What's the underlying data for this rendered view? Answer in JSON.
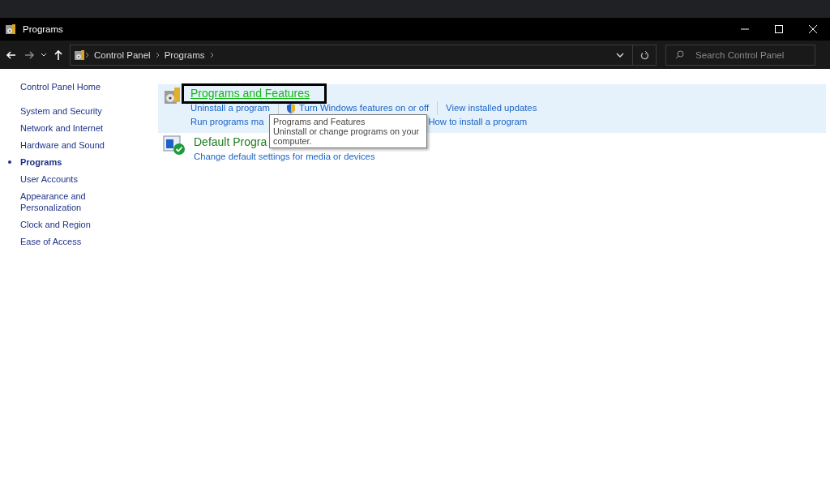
{
  "window": {
    "title": "Programs"
  },
  "address_bar": {
    "crumbs": [
      "Control Panel",
      "Programs"
    ]
  },
  "search": {
    "placeholder": "Search Control Panel"
  },
  "sidebar": {
    "home": "Control Panel Home",
    "items": [
      {
        "label": "System and Security",
        "selected": false
      },
      {
        "label": "Network and Internet",
        "selected": false
      },
      {
        "label": "Hardware and Sound",
        "selected": false
      },
      {
        "label": "Programs",
        "selected": true
      },
      {
        "label": "User Accounts",
        "selected": false
      },
      {
        "label": "Appearance and Personalization",
        "selected": false
      },
      {
        "label": "Clock and Region",
        "selected": false
      },
      {
        "label": "Ease of Access",
        "selected": false
      }
    ]
  },
  "categories": [
    {
      "title": "Programs and Features",
      "highlighted": true,
      "task_lines": [
        {
          "links": [
            {
              "text": "Uninstall a program"
            },
            {
              "text": "Turn Windows features on or off",
              "shield": true
            },
            {
              "text": "View installed updates"
            }
          ]
        },
        {
          "links": [
            {
              "text": "Run programs ma"
            },
            {
              "text": "How to install a program"
            }
          ]
        }
      ]
    },
    {
      "title": "Default Progra",
      "highlighted": false,
      "task_lines": [
        {
          "links": [
            {
              "text": "Change default settings for media or devices"
            }
          ]
        }
      ]
    }
  ],
  "tooltip": {
    "title": "Programs and Features",
    "text": "Uninstall or change programs on your computer."
  }
}
